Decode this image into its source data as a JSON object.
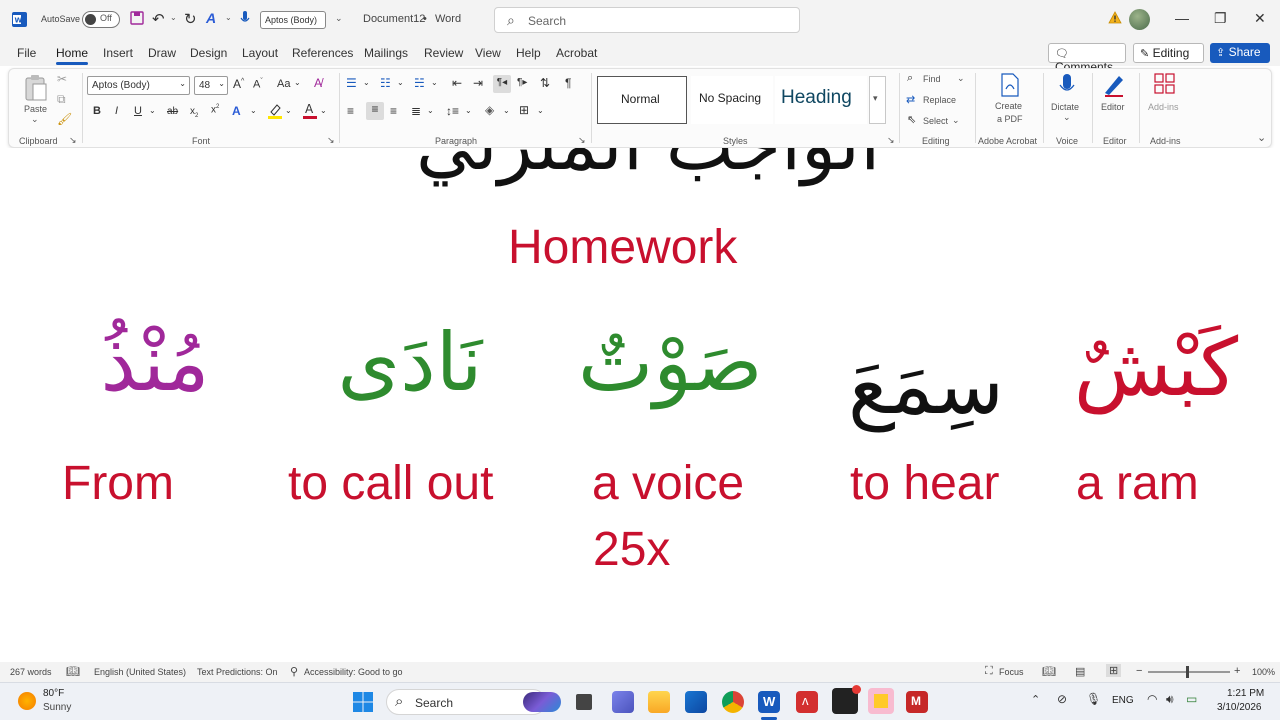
{
  "titlebar": {
    "autosave_label": "AutoSave",
    "autosave_state": "Off",
    "font_name": "Aptos (Body)",
    "doc_title": "Document12",
    "title_sep": "•",
    "app_name": "Word",
    "search_placeholder": "Search"
  },
  "menu": {
    "tabs": [
      "File",
      "Home",
      "Insert",
      "Draw",
      "Design",
      "Layout",
      "References",
      "Mailings",
      "Review",
      "View",
      "Help",
      "Acrobat"
    ],
    "comments_label": "Comments",
    "editing_label": "Editing",
    "share_label": "Share"
  },
  "ribbon": {
    "clipboard": {
      "paste_label": "Paste",
      "group_label": "Clipboard"
    },
    "font": {
      "font_name": "Aptos (Body)",
      "font_size": "48",
      "group_label": "Font",
      "change_case": "Aa"
    },
    "paragraph": {
      "group_label": "Paragraph"
    },
    "styles": {
      "items": [
        "Normal",
        "No Spacing",
        "Heading"
      ],
      "group_label": "Styles"
    },
    "editing": {
      "find_label": "Find",
      "replace_label": "Replace",
      "select_label": "Select",
      "group_label": "Editing"
    },
    "acrobat": {
      "create_pdf_line1": "Create",
      "create_pdf_line2": "a PDF",
      "group_label": "Adobe Acrobat"
    },
    "voice": {
      "dictate_label": "Dictate",
      "group_label": "Voice"
    },
    "editor": {
      "editor_label": "Editor",
      "group_label": "Editor"
    },
    "addins": {
      "addins_label": "Add-ins",
      "group_label": "Add-ins"
    }
  },
  "document": {
    "top_arabic": "الواجب المنزلي",
    "heading": "Homework",
    "words": [
      {
        "arabic": "مُنْذُ",
        "english": "From",
        "color": "#a0289a"
      },
      {
        "arabic": "نَادَى",
        "english": "to call out",
        "color": "#2e8b2e"
      },
      {
        "arabic": "صَوْتٌ",
        "english": "a voice",
        "color": "#2e8b2e"
      },
      {
        "arabic": "سِمَعَ",
        "english": "to hear",
        "color": "#111111"
      },
      {
        "arabic": "كَبْشٌ",
        "english": "a ram",
        "color": "#c8102e"
      }
    ],
    "extra_note": "25x",
    "accent_color": "#c8102e"
  },
  "statusbar": {
    "word_count": "267 words",
    "language": "English (United States)",
    "text_predictions": "Text Predictions: On",
    "accessibility": "Accessibility: Good to go",
    "focus_label": "Focus",
    "zoom": "100%"
  },
  "taskbar": {
    "weather_temp": "80°F",
    "weather_desc": "Sunny",
    "search_placeholder": "Search",
    "lang": "ENG",
    "time": "1:21 PM",
    "date": "3/10/2026"
  }
}
